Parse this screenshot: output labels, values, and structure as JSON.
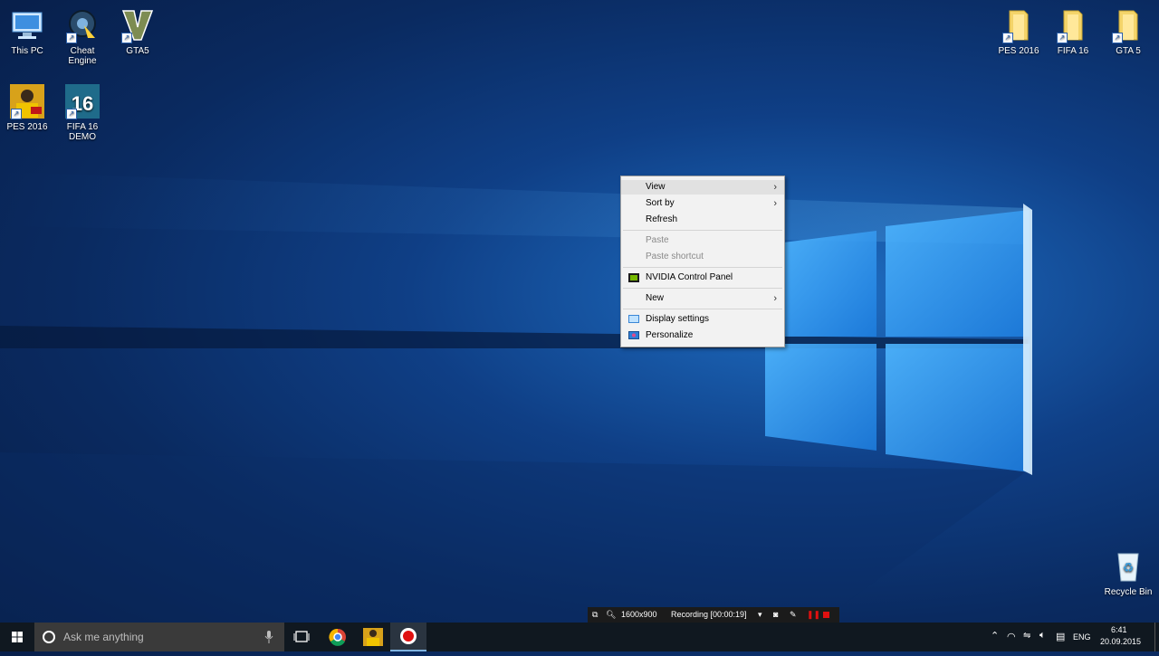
{
  "desktop_icons_left": [
    {
      "label": "This PC",
      "icon": "computer-icon"
    },
    {
      "label": "Cheat Engine",
      "icon": "cheat-engine-icon"
    },
    {
      "label": "GTA5",
      "icon": "gta-v-icon"
    },
    {
      "label": "PES 2016",
      "icon": "pes-icon"
    },
    {
      "label": "FIFA 16 DEMO",
      "icon": "fifa16-icon"
    }
  ],
  "desktop_icons_right": [
    {
      "label": "PES 2016",
      "icon": "folder-icon"
    },
    {
      "label": "FIFA 16",
      "icon": "folder-icon"
    },
    {
      "label": "GTA 5",
      "icon": "folder-icon"
    }
  ],
  "recycle_bin": {
    "label": "Recycle Bin",
    "icon": "recycle-bin-icon"
  },
  "context_menu": {
    "view": "View",
    "sort_by": "Sort by",
    "refresh": "Refresh",
    "paste": "Paste",
    "paste_shortcut": "Paste shortcut",
    "nvidia": "NVIDIA Control Panel",
    "new": "New",
    "display_settings": "Display settings",
    "personalize": "Personalize"
  },
  "recorder": {
    "resolution": "1600x900",
    "status": "Recording [00:00:19]"
  },
  "taskbar": {
    "search_placeholder": "Ask me anything",
    "language": "ENG",
    "time": "6:41",
    "date": "20.09.2015"
  },
  "colors": {
    "accent": "#1f6fc4",
    "taskbar": "#101820",
    "record_red": "#e01010"
  }
}
